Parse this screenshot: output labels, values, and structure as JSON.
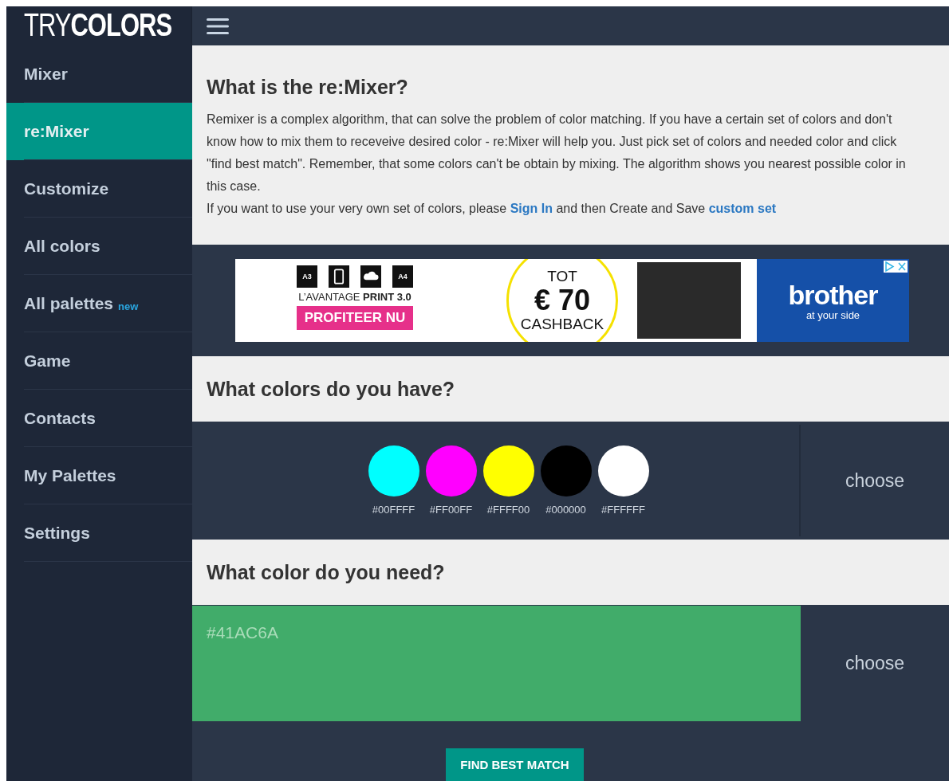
{
  "logo": "TRY**COLORS**",
  "sidebar": {
    "items": [
      {
        "label": "Mixer",
        "selected": false
      },
      {
        "label": "re:Mixer",
        "selected": true
      },
      {
        "label": "Customize",
        "selected": false
      },
      {
        "label": "All colors",
        "selected": false
      },
      {
        "label": "All palettes",
        "selected": false,
        "badge": "new"
      },
      {
        "label": "Game",
        "selected": false
      },
      {
        "label": "Contacts",
        "selected": false
      },
      {
        "label": "My Palettes",
        "selected": false
      },
      {
        "label": "Settings",
        "selected": false
      }
    ]
  },
  "intro": {
    "title": "What is the re:Mixer?",
    "paragraph": "Remixer is a complex algorithm, that can solve the problem of color matching. If you have a certain set of colors and don't know how to mix them to receveive desired color - re:Mixer will help you. Just pick set of colors and needed color and click \"find best match\". Remember, that some colors can't be obtain by mixing. The algorithm shows you nearest possible color in this case.",
    "note": [
      {
        "kind": "text",
        "text": "If you want to use your very own set of colors, please "
      },
      {
        "kind": "link",
        "text": "Sign In"
      },
      {
        "kind": "text",
        "text": " and then Create and Save "
      },
      {
        "kind": "link",
        "text": "custom set"
      }
    ]
  },
  "ad": {
    "format_labels": [
      "A3",
      "A4"
    ],
    "tagline": "L’AVANTAGE **PRINT 3.0**",
    "cta": "PROFITEER NU",
    "offer_top": "TOT",
    "offer_amount": "€ 70",
    "offer_bottom": "CASHBACK",
    "brand": "brother",
    "slogan": "at your side"
  },
  "have": {
    "title": "What colors do you have?",
    "choose": "choose",
    "colors": [
      {
        "color": "#00ffff",
        "label": "#00FFFF"
      },
      {
        "color": "#ff00ff",
        "label": "#FF00FF"
      },
      {
        "color": "#ffff00",
        "label": "#FFFF00"
      },
      {
        "color": "#000000",
        "label": "#000000"
      },
      {
        "color": "#ffffff",
        "label": "#FFFFFF"
      }
    ]
  },
  "need": {
    "title": "What color do you need?",
    "color": "#41ac6a",
    "label": "#41AC6A",
    "choose": "choose"
  },
  "button": "FIND BEST MATCH"
}
